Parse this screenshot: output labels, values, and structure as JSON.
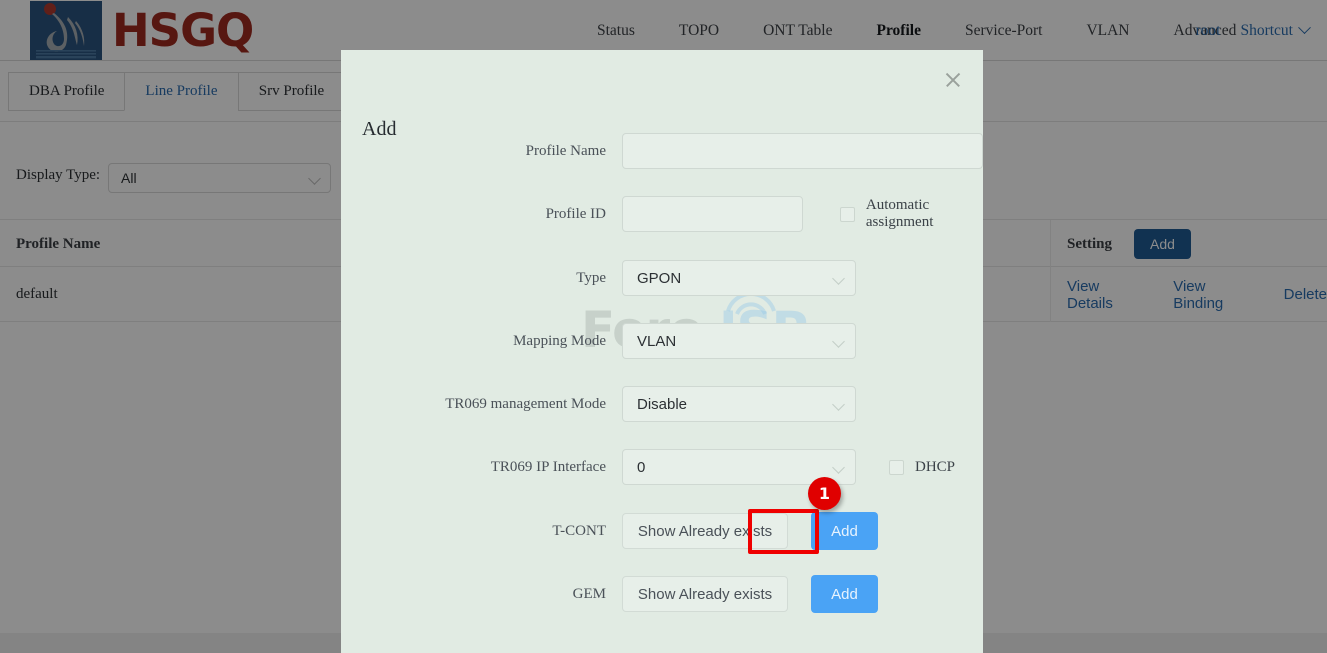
{
  "header": {
    "brand": "HSGQ",
    "logo_icon": "hsgq-logo-icon",
    "nav": [
      {
        "label": "Status",
        "active": false
      },
      {
        "label": "TOPO",
        "active": false
      },
      {
        "label": "ONT Table",
        "active": false
      },
      {
        "label": "Profile",
        "active": true
      },
      {
        "label": "Service-Port",
        "active": false
      },
      {
        "label": "VLAN",
        "active": false
      },
      {
        "label": "Advanced",
        "active": false
      }
    ],
    "user": "root",
    "shortcut": "Shortcut"
  },
  "tabs": [
    {
      "label": "DBA Profile",
      "active": false
    },
    {
      "label": "Line Profile",
      "active": true
    },
    {
      "label": "Srv Profile",
      "active": false
    }
  ],
  "filter": {
    "label": "Display Type:",
    "value": "All"
  },
  "table": {
    "columns": [
      "Profile Name",
      "Setting"
    ],
    "add_button": "Add",
    "rows": [
      {
        "profile_name": "default",
        "actions": [
          "View Details",
          "View Binding",
          "Delete"
        ]
      }
    ]
  },
  "watermark": {
    "part1": "Foro",
    "part2": "ISP"
  },
  "modal": {
    "title": "Add",
    "close_icon": "close-icon",
    "fields": {
      "profile_name": {
        "label": "Profile Name",
        "value": "",
        "placeholder": ""
      },
      "profile_id": {
        "label": "Profile ID",
        "value": "",
        "placeholder": ""
      },
      "automatic_assignment": {
        "label": "Automatic assignment",
        "checked": false
      },
      "type": {
        "label": "Type",
        "value": "GPON"
      },
      "mapping_mode": {
        "label": "Mapping Mode",
        "value": "VLAN"
      },
      "tr069_management_mode": {
        "label": "TR069 management Mode",
        "value": "Disable"
      },
      "tr069_ip_interface": {
        "label": "TR069 IP Interface",
        "value": "0"
      },
      "dhcp": {
        "label": "DHCP",
        "checked": false
      },
      "tcont": {
        "label": "T-CONT",
        "show_button": "Show Already exists",
        "add_button": "Add"
      },
      "gem": {
        "label": "GEM",
        "show_button": "Show Already exists",
        "add_button": "Add"
      }
    }
  },
  "annotation": {
    "step_number": "1",
    "highlight_color": "#ef0000",
    "badge_color": "#e00000"
  },
  "colors": {
    "brand_red": "#9e2b20",
    "logo_blue": "#2a5580",
    "link_blue": "#2b6cb0",
    "button_blue": "#4aa3f5",
    "table_add_blue": "#1f5b94",
    "modal_bg": "#e1ebe3"
  }
}
